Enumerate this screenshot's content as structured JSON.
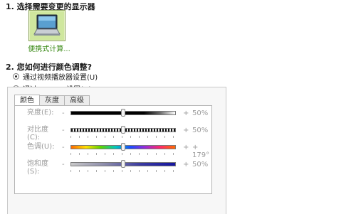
{
  "step1": {
    "title": "1. 选择需要变更的显示器"
  },
  "display": {
    "label": "便携式计算...",
    "icon": "laptop-icon"
  },
  "step2": {
    "title": "2. 您如何进行颜色调整?",
    "options": [
      {
        "label": "通过视频播放器设置(U)",
        "checked": true
      },
      {
        "label": "通过 NVIDIA 设置(N)",
        "checked": false
      }
    ]
  },
  "tabs": [
    {
      "label": "颜色",
      "active": true
    },
    {
      "label": "灰度",
      "active": false
    },
    {
      "label": "高级",
      "active": false
    }
  ],
  "sliders": [
    {
      "label": "亮度(E):",
      "label2": "",
      "dash": "-",
      "plus": "+",
      "value": "50%",
      "level": 0.5
    },
    {
      "label": "对比度",
      "label2": "(C):",
      "dash": "-",
      "plus": "+",
      "value": "50%",
      "level": 0.5
    },
    {
      "label": "色调(U):",
      "label2": "",
      "dash": "-",
      "plus": "+",
      "value": "+ 179°",
      "level": 0.5
    },
    {
      "label": "饱和度",
      "label2": "(S):",
      "dash": "-",
      "plus": "+",
      "value": "50%",
      "level": 0.5
    }
  ],
  "colors": {
    "accent_green": "#3a8a16",
    "tile_bg": "#cfe79e"
  }
}
